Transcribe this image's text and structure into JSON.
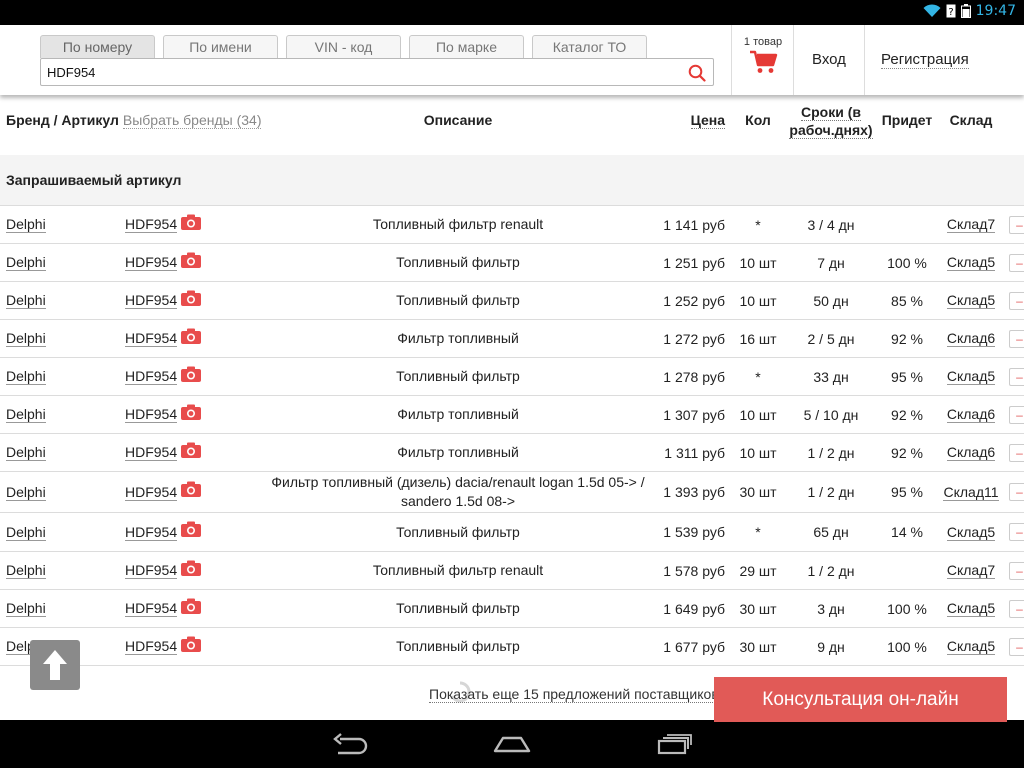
{
  "status_bar": {
    "time": "19:47",
    "accent_color": "#33b5e5",
    "icons": [
      "wifi-icon",
      "sim-icon",
      "battery-icon"
    ]
  },
  "header": {
    "tabs": [
      {
        "label": "По номеру",
        "active": true
      },
      {
        "label": "По имени",
        "active": false
      },
      {
        "label": "VIN - код",
        "active": false
      },
      {
        "label": "По марке",
        "active": false
      },
      {
        "label": "Каталог ТО",
        "active": false
      }
    ],
    "search": {
      "value": "HDF954",
      "icon": "search-icon"
    },
    "cart": {
      "count_label": "1 товар",
      "icon": "cart-icon",
      "color": "#e53935"
    },
    "login": "Вход",
    "register": "Регистрация"
  },
  "table": {
    "headers": {
      "brand_article": "Бренд / Артикул",
      "select_brands": "Выбрать бренды (34)",
      "description": "Описание",
      "price": "Цена",
      "qty": "Кол",
      "term": "Сроки (в рабоч.днях)",
      "probability": "Придет",
      "warehouse": "Склад"
    },
    "section_title": "Запрашиваемый артикул",
    "rows": [
      {
        "brand": "Delphi",
        "article": "HDF954",
        "description": "Топливный фильтр renault",
        "price": "1 141 руб",
        "qty": "*",
        "term": "3 / 4 дн",
        "probability": "",
        "warehouse": "Склад7"
      },
      {
        "brand": "Delphi",
        "article": "HDF954",
        "description": "Топливный фильтр",
        "price": "1 251 руб",
        "qty": "10 шт",
        "term": "7 дн",
        "probability": "100 %",
        "warehouse": "Склад5"
      },
      {
        "brand": "Delphi",
        "article": "HDF954",
        "description": "Топливный фильтр",
        "price": "1 252 руб",
        "qty": "10 шт",
        "term": "50 дн",
        "probability": "85 %",
        "warehouse": "Склад5"
      },
      {
        "brand": "Delphi",
        "article": "HDF954",
        "description": "Фильтр топливный",
        "price": "1 272 руб",
        "qty": "16 шт",
        "term": "2 / 5 дн",
        "probability": "92 %",
        "warehouse": "Склад6"
      },
      {
        "brand": "Delphi",
        "article": "HDF954",
        "description": "Топливный фильтр",
        "price": "1 278 руб",
        "qty": "*",
        "term": "33 дн",
        "probability": "95 %",
        "warehouse": "Склад5"
      },
      {
        "brand": "Delphi",
        "article": "HDF954",
        "description": "Фильтр топливный",
        "price": "1 307 руб",
        "qty": "10 шт",
        "term": "5 / 10 дн",
        "probability": "92 %",
        "warehouse": "Склад6"
      },
      {
        "brand": "Delphi",
        "article": "HDF954",
        "description": "Фильтр топливный",
        "price": "1 311 руб",
        "qty": "10 шт",
        "term": "1 / 2 дн",
        "probability": "92 %",
        "warehouse": "Склад6"
      },
      {
        "brand": "Delphi",
        "article": "HDF954",
        "description": "Фильтр топливный (дизель) dacia/renault logan 1.5d 05-> / sandero 1.5d 08->",
        "price": "1 393 руб",
        "qty": "30 шт",
        "term": "1 / 2 дн",
        "probability": "95 %",
        "warehouse": "Склад11"
      },
      {
        "brand": "Delphi",
        "article": "HDF954",
        "description": "Топливный фильтр",
        "price": "1 539 руб",
        "qty": "*",
        "term": "65 дн",
        "probability": "14 %",
        "warehouse": "Склад5"
      },
      {
        "brand": "Delphi",
        "article": "HDF954",
        "description": "Топливный фильтр renault",
        "price": "1 578 руб",
        "qty": "29 шт",
        "term": "1 / 2 дн",
        "probability": "",
        "warehouse": "Склад7"
      },
      {
        "brand": "Delphi",
        "article": "HDF954",
        "description": "Топливный фильтр",
        "price": "1 649 руб",
        "qty": "30 шт",
        "term": "3 дн",
        "probability": "100 %",
        "warehouse": "Склад5"
      },
      {
        "brand": "Delphi",
        "article": "HDF954",
        "description": "Топливный фильтр",
        "price": "1 677 руб",
        "qty": "30 шт",
        "term": "9 дн",
        "probability": "100 %",
        "warehouse": "Склад5"
      }
    ],
    "row_add_label": "–"
  },
  "more_offers": "Показать еще 15 предложений поставщиков",
  "consult_button": "Консультация он-лайн",
  "accent_color": "#e15a57",
  "nav_bar": {
    "icons": [
      "back-icon",
      "home-icon",
      "recents-icon"
    ]
  }
}
